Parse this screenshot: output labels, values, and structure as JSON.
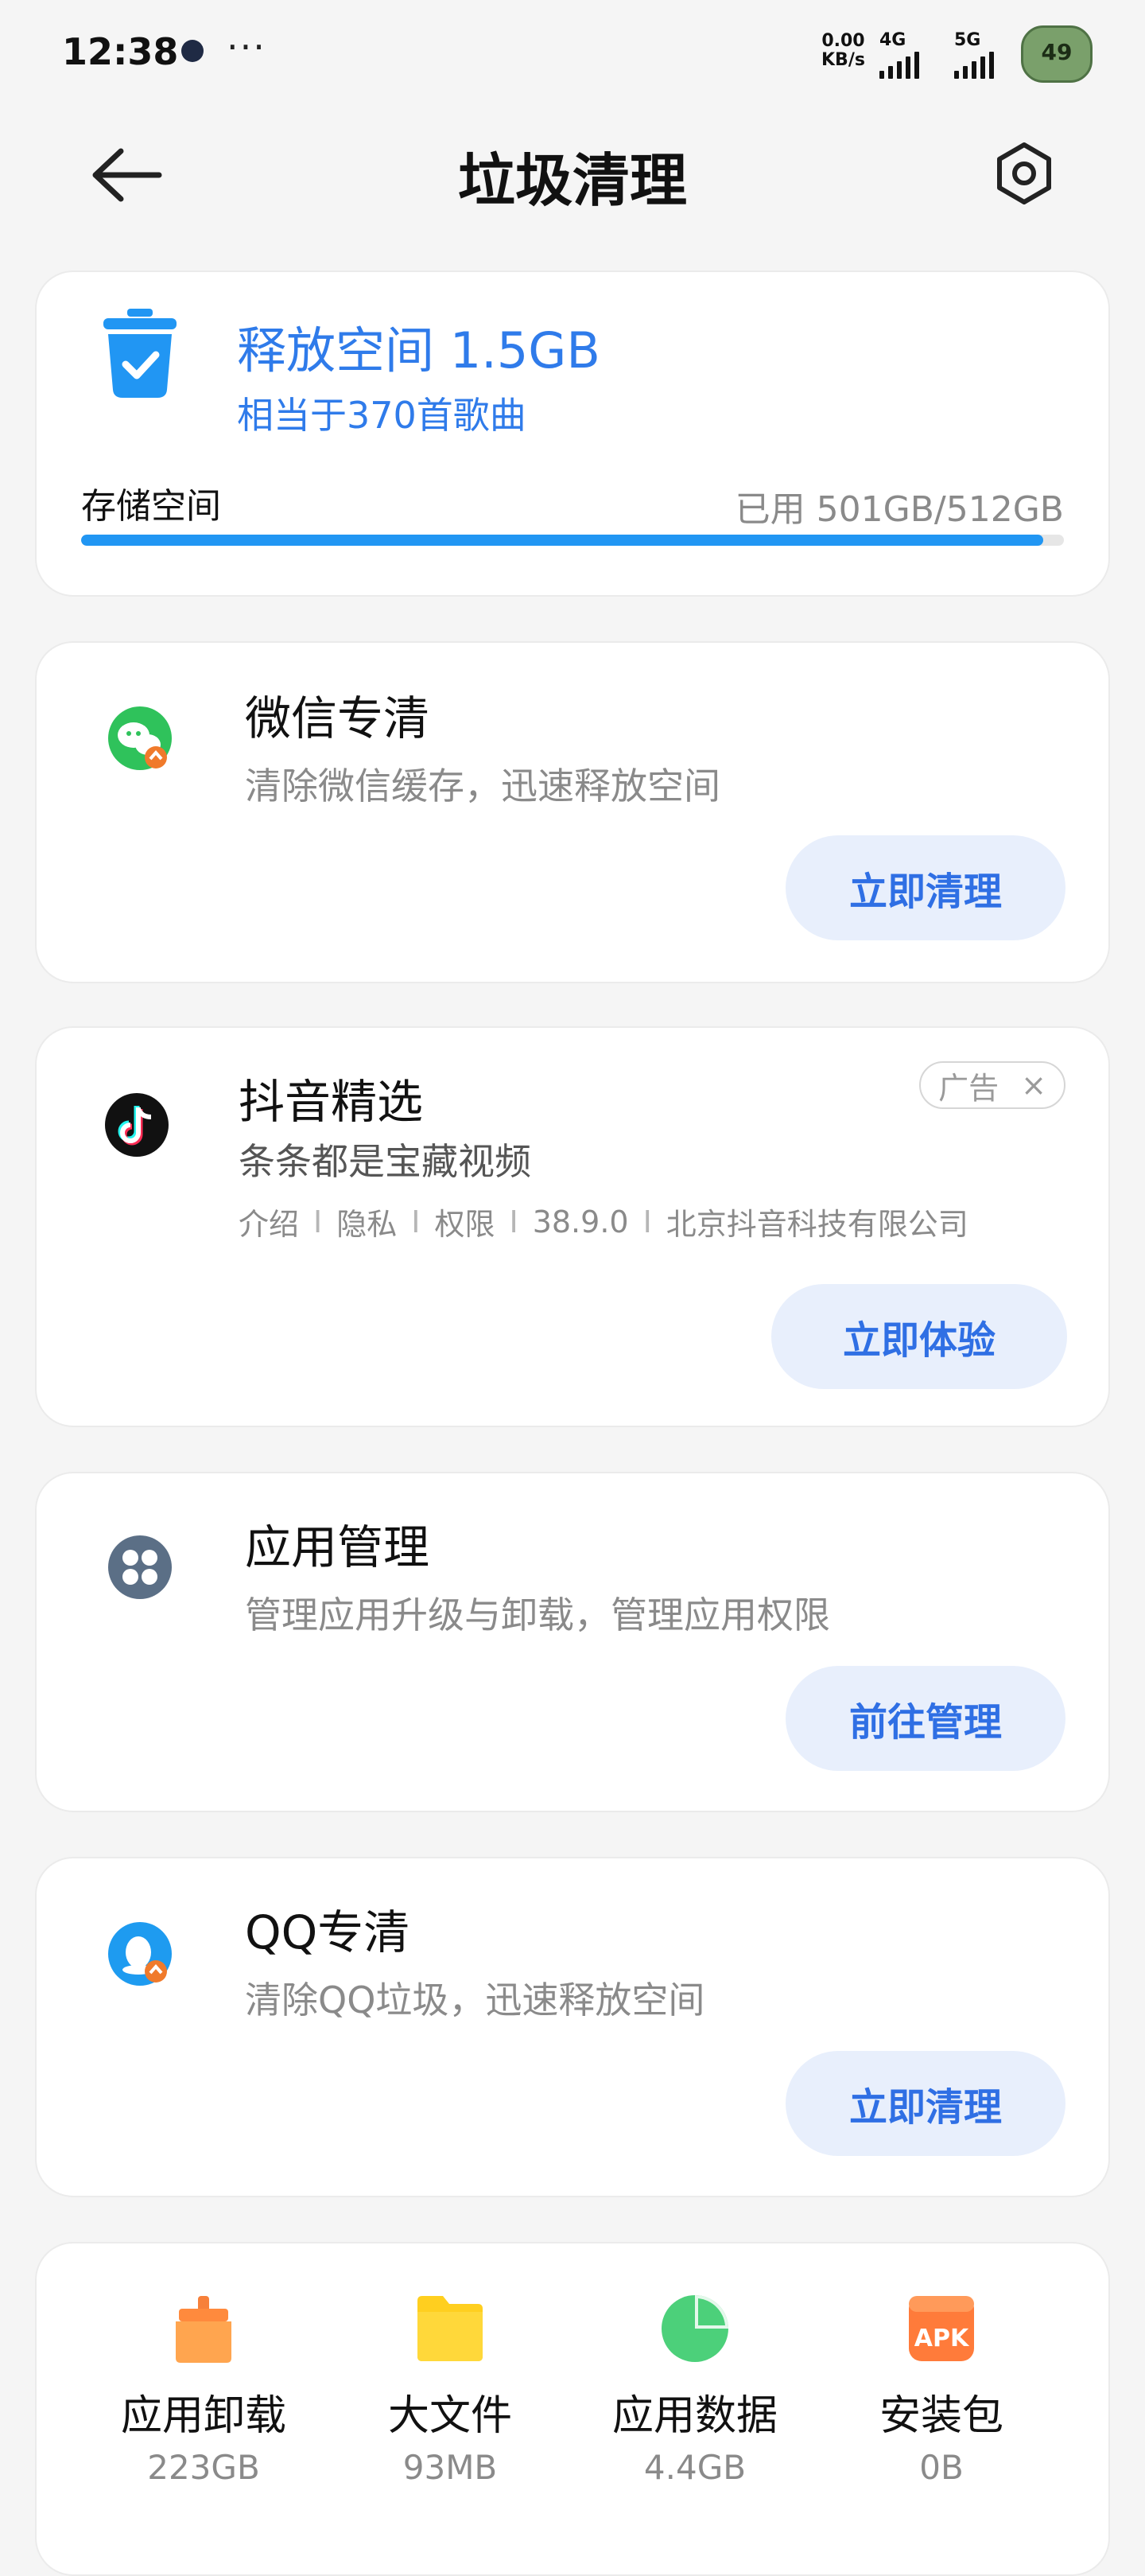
{
  "status_bar": {
    "time": "12:38",
    "more": "···",
    "net_speed_value": "0.00",
    "net_speed_unit": "KB/s",
    "sim1": "4G",
    "sim2": "5G",
    "battery": "49"
  },
  "header": {
    "title": "垃圾清理"
  },
  "storage_card": {
    "free_title": "释放空间 1.5GB",
    "free_sub": "相当于370首歌曲",
    "label": "存储空间",
    "used_text": "已用 501GB/512GB",
    "used_fraction": 0.979
  },
  "cards": [
    {
      "title": "微信专清",
      "subtitle": "清除微信缓存，迅速释放空间",
      "button": "立即清理",
      "icon": "wechat-icon"
    },
    {
      "title": "抖音精选",
      "subtitle": "条条都是宝藏视频",
      "button": "立即体验",
      "icon": "douyin-icon",
      "ad_label": "广告",
      "ad_close": "×",
      "meta": [
        "介绍",
        "隐私",
        "权限",
        "38.9.0",
        "北京抖音科技有限公司"
      ],
      "meta_sep": "I"
    },
    {
      "title": "应用管理",
      "subtitle": "管理应用升级与卸载，管理应用权限",
      "button": "前往管理",
      "icon": "app-manage-icon"
    },
    {
      "title": "QQ专清",
      "subtitle": "清除QQ垃圾，迅速释放空间",
      "button": "立即清理",
      "icon": "qq-icon"
    }
  ],
  "tools": [
    {
      "name": "应用卸载",
      "size": "223GB",
      "icon": "broom-icon"
    },
    {
      "name": "大文件",
      "size": "93MB",
      "icon": "folder-icon"
    },
    {
      "name": "应用数据",
      "size": "4.4GB",
      "icon": "pie-chart-icon"
    },
    {
      "name": "安装包",
      "size": "0B",
      "icon": "apk-icon",
      "badge": "APK"
    }
  ],
  "colors": {
    "accent": "#2f7bea",
    "button_bg": "#e8effc",
    "progress": "#2196f3"
  }
}
